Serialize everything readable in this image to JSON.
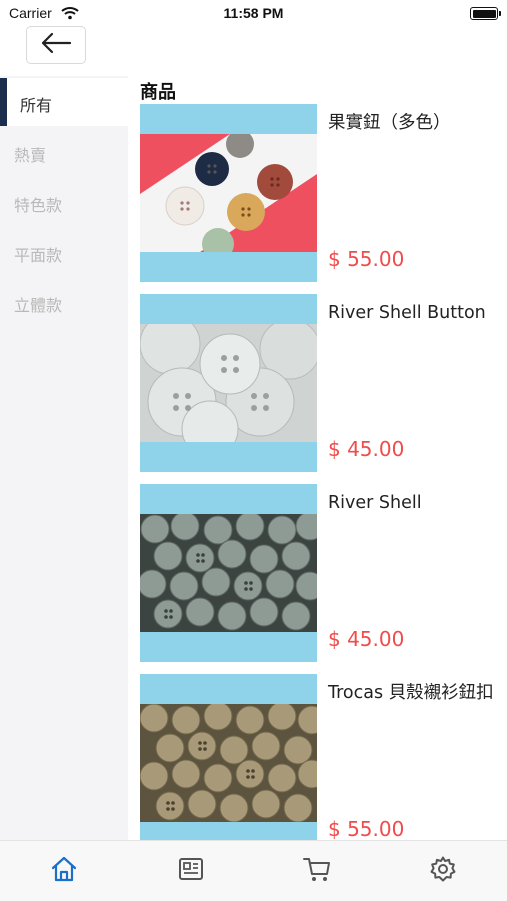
{
  "status_bar": {
    "carrier": "Carrier",
    "time": "11:58 PM"
  },
  "header": {
    "back_icon": "arrow-left-icon"
  },
  "sidebar": {
    "items": [
      {
        "label": "所有",
        "active": true
      },
      {
        "label": "熱賣",
        "active": false
      },
      {
        "label": "特色款",
        "active": false
      },
      {
        "label": "平面款",
        "active": false
      },
      {
        "label": "立體款",
        "active": false
      }
    ]
  },
  "main": {
    "section_title": "商品",
    "products": [
      {
        "name": "果實鈕（多色）",
        "price": "$ 55.00"
      },
      {
        "name": "River Shell Button",
        "price": "$ 45.00"
      },
      {
        "name": "River Shell",
        "price": "$ 45.00"
      },
      {
        "name": "Trocas 貝殼襯衫鈕扣",
        "price": "$ 55.00"
      }
    ]
  },
  "tabbar": {
    "tabs": [
      {
        "icon": "home-icon",
        "active": true
      },
      {
        "icon": "news-icon",
        "active": false
      },
      {
        "icon": "cart-icon",
        "active": false
      },
      {
        "icon": "gear-icon",
        "active": false
      }
    ]
  },
  "colors": {
    "accent": "#1b6fc8",
    "price": "#ef4c4c",
    "sidebar_indicator": "#1b2e4d",
    "thumb_band": "#8fd3ea"
  }
}
